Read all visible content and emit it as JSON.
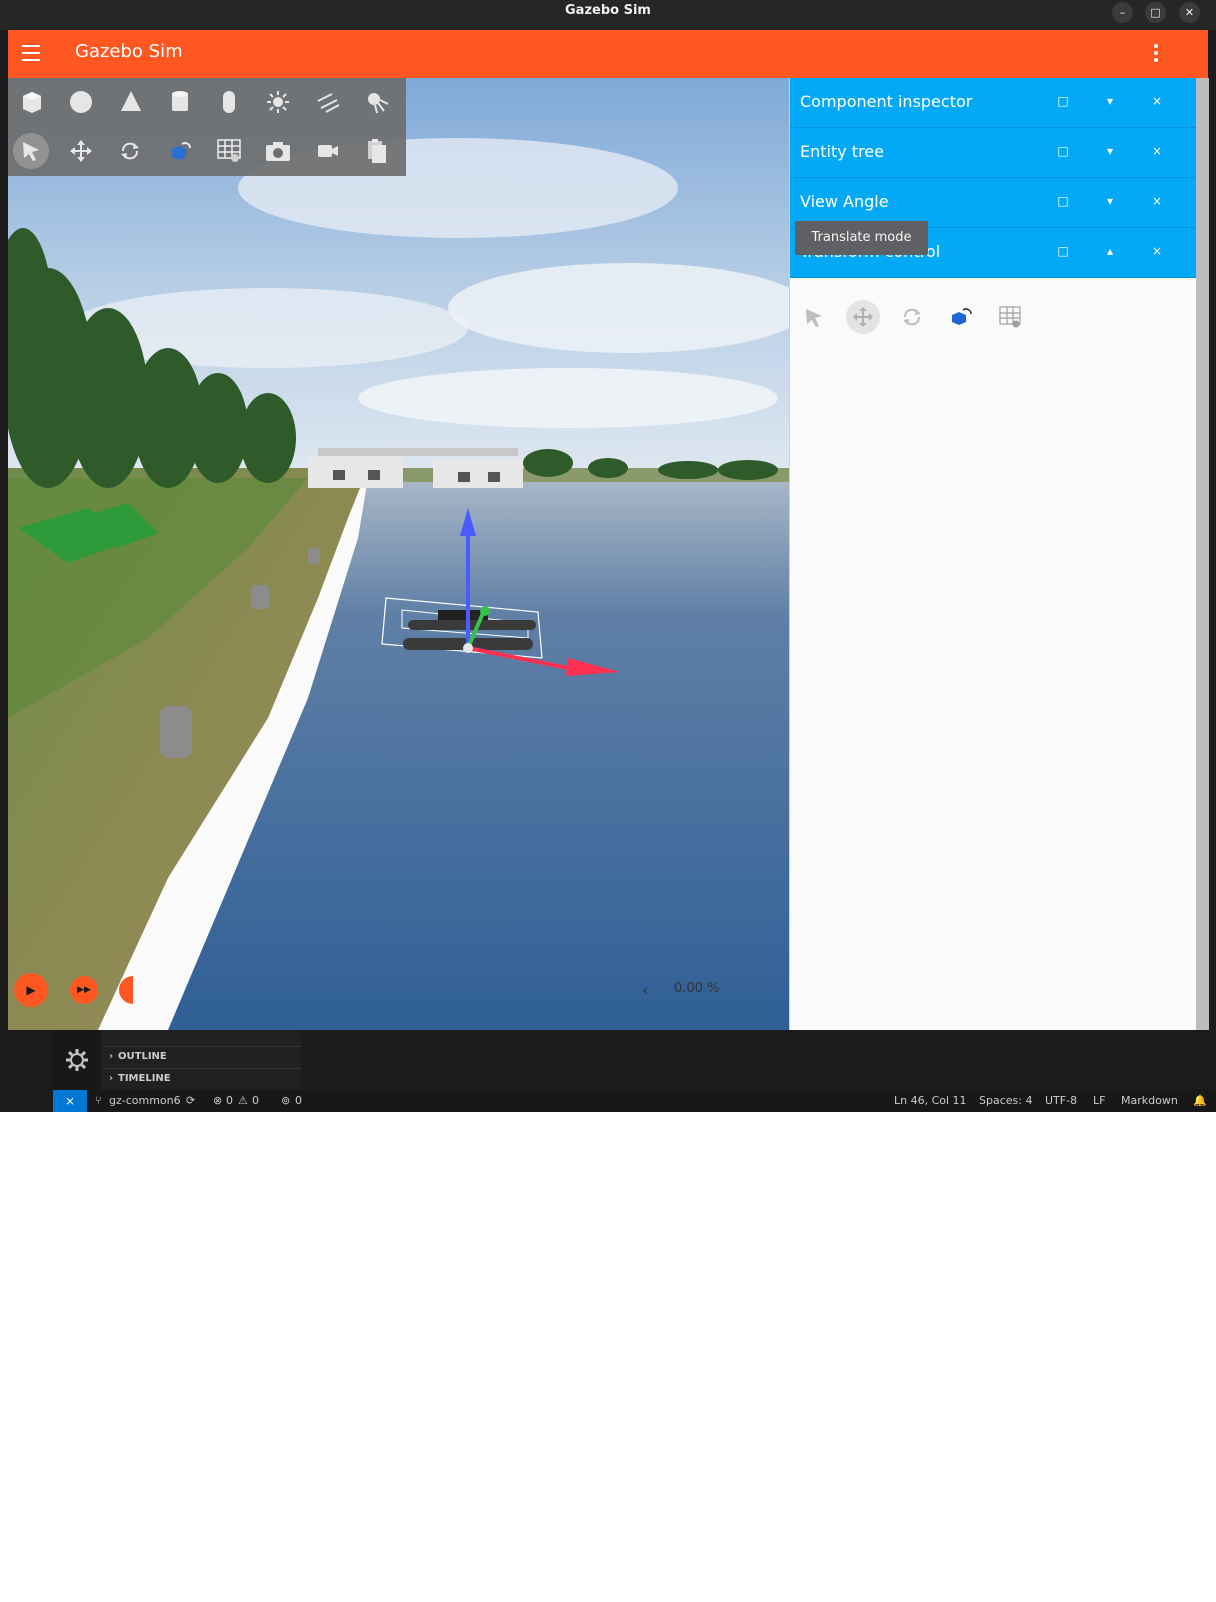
{
  "window": {
    "title": "Gazebo Sim",
    "controls": [
      "minimize",
      "maximize",
      "close"
    ]
  },
  "app": {
    "title": "Gazebo Sim",
    "accent_color": "#ff5722"
  },
  "toolbar": {
    "row1": [
      "box-icon",
      "sphere-icon",
      "cone-icon",
      "cylinder-icon",
      "capsule-icon",
      "sun-light-icon",
      "directional-light-icon",
      "spot-light-icon"
    ],
    "row2": [
      "select-icon",
      "translate-icon",
      "rotate-icon",
      "view-angle-icon",
      "grid-icon",
      "screenshot-icon",
      "video-record-icon",
      "paste-icon"
    ]
  },
  "playback": {
    "real_time_factor": "0.00 %",
    "collapse_label": "‹"
  },
  "panel": {
    "accent_color": "#03a9f4",
    "plugins": [
      {
        "title": "Component inspector",
        "expand_label": "□",
        "collapse_label": "▾",
        "close_label": "×"
      },
      {
        "title": "Entity tree",
        "expand_label": "□",
        "collapse_label": "▾",
        "close_label": "×"
      },
      {
        "title": "View Angle",
        "expand_label": "□",
        "collapse_label": "▾",
        "close_label": "×"
      },
      {
        "title": "Transform control",
        "expand_label": "□",
        "collapse_label": "▴",
        "close_label": "×"
      }
    ],
    "transform_tools": [
      "select-icon",
      "translate-icon",
      "rotate-icon",
      "snap-icon",
      "grid-icon"
    ]
  },
  "tooltip": {
    "text": "Translate mode"
  },
  "editor": {
    "sections": [
      "OUTLINE",
      "TIMELINE"
    ],
    "status": {
      "branch": "gz-common6",
      "errors": "0",
      "warnings": "0",
      "ports": "0",
      "position": "Ln 46, Col 11",
      "spaces": "Spaces: 4",
      "encoding": "UTF-8",
      "eol": "LF",
      "language": "Markdown"
    }
  }
}
